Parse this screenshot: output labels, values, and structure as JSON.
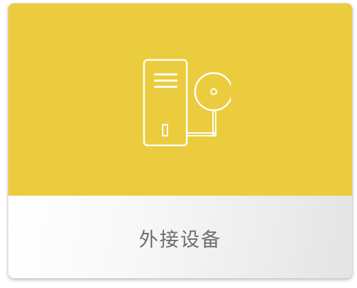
{
  "card": {
    "label": "外接设备",
    "icon": "external-device-icon"
  },
  "colors": {
    "tile_background": "#ebcc3e",
    "icon_stroke": "#ffffff",
    "label_text": "#6e6e6e"
  }
}
